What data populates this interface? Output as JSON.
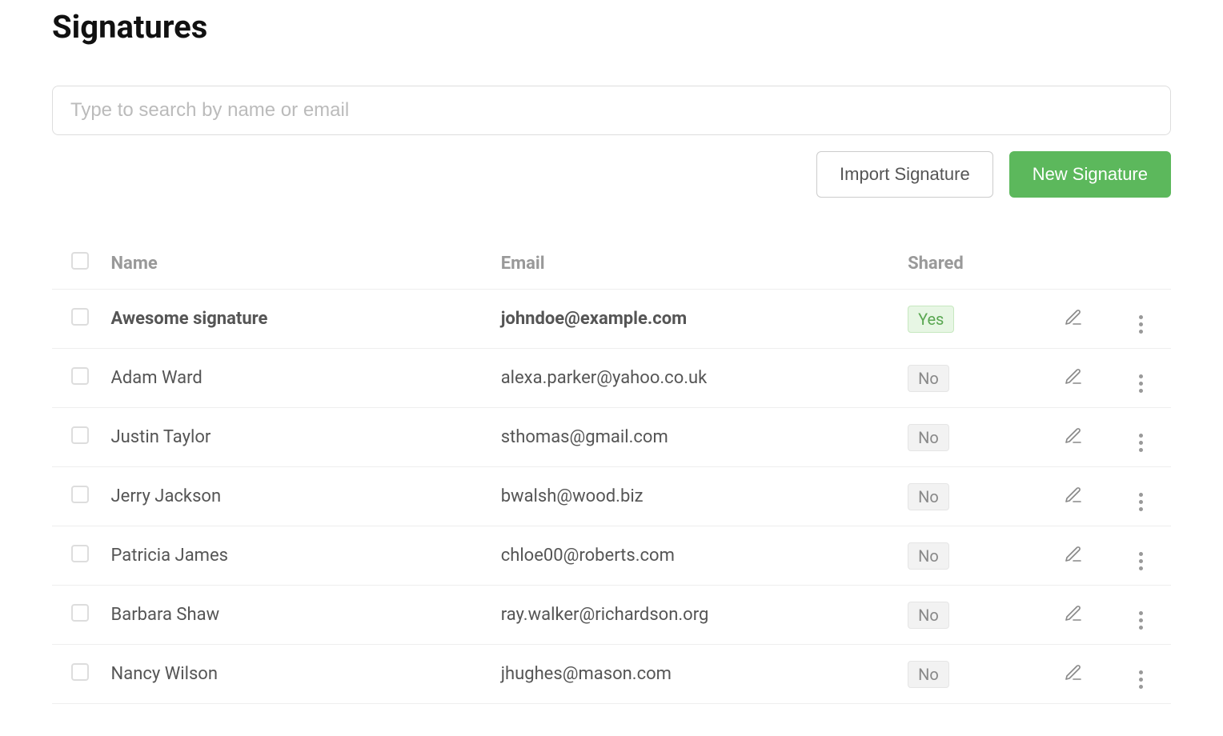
{
  "page": {
    "title": "Signatures"
  },
  "search": {
    "placeholder": "Type to search by name or email",
    "value": ""
  },
  "toolbar": {
    "import_label": "Import Signature",
    "new_label": "New Signature"
  },
  "table": {
    "headers": {
      "name": "Name",
      "email": "Email",
      "shared": "Shared"
    },
    "shared_yes": "Yes",
    "shared_no": "No",
    "rows": [
      {
        "name": "Awesome signature",
        "email": "johndoe@example.com",
        "shared": true,
        "bold": true
      },
      {
        "name": "Adam Ward",
        "email": "alexa.parker@yahoo.co.uk",
        "shared": false,
        "bold": false
      },
      {
        "name": "Justin Taylor",
        "email": "sthomas@gmail.com",
        "shared": false,
        "bold": false
      },
      {
        "name": "Jerry Jackson",
        "email": "bwalsh@wood.biz",
        "shared": false,
        "bold": false
      },
      {
        "name": "Patricia James",
        "email": "chloe00@roberts.com",
        "shared": false,
        "bold": false
      },
      {
        "name": "Barbara Shaw",
        "email": "ray.walker@richardson.org",
        "shared": false,
        "bold": false
      },
      {
        "name": "Nancy Wilson",
        "email": "jhughes@mason.com",
        "shared": false,
        "bold": false
      }
    ]
  }
}
